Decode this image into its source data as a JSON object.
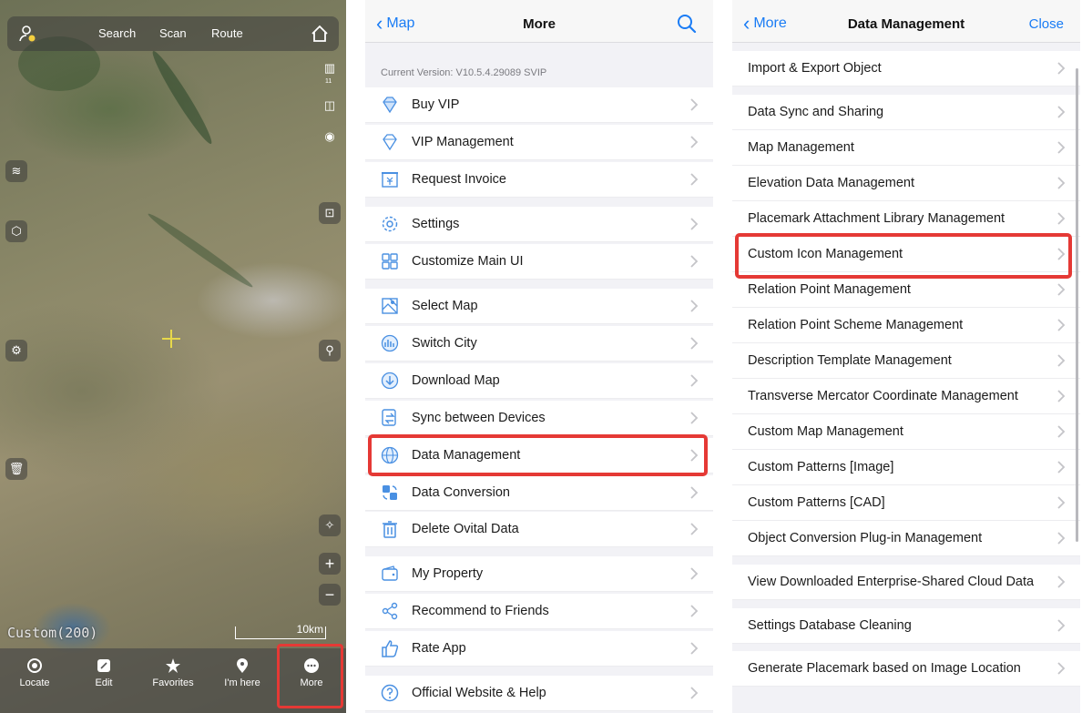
{
  "map_screen": {
    "top_bar": {
      "search": "Search",
      "scan": "Scan",
      "route": "Route"
    },
    "map_source_label": "Custom(200)",
    "scale_label": "10km",
    "bottom_tabs": [
      {
        "label": "Locate",
        "icon": "locate-icon"
      },
      {
        "label": "Edit",
        "icon": "edit-icon"
      },
      {
        "label": "Favorites",
        "icon": "star-icon"
      },
      {
        "label": "I'm here",
        "icon": "pin-icon"
      },
      {
        "label": "More",
        "icon": "more-icon"
      }
    ],
    "side_small_label": "11"
  },
  "more_screen": {
    "back_label": "Map",
    "title": "More",
    "version": "Current Version: V10.5.4.29089 SVIP",
    "items": [
      {
        "label": "Buy VIP",
        "icon": "diamond-icon"
      },
      {
        "label": "VIP Management",
        "icon": "diamond-outline-icon"
      },
      {
        "label": "Request Invoice",
        "icon": "invoice-icon"
      },
      {
        "label": "Settings",
        "icon": "gear-icon"
      },
      {
        "label": "Customize Main UI",
        "icon": "grid-icon"
      },
      {
        "label": "Select Map",
        "icon": "map-icon"
      },
      {
        "label": "Switch City",
        "icon": "city-icon"
      },
      {
        "label": "Download Map",
        "icon": "download-icon"
      },
      {
        "label": "Sync between Devices",
        "icon": "sync-icon"
      },
      {
        "label": "Data Management",
        "icon": "globe-icon"
      },
      {
        "label": "Data Conversion",
        "icon": "convert-icon"
      },
      {
        "label": "Delete Ovital Data",
        "icon": "trash-icon"
      },
      {
        "label": "My Property",
        "icon": "wallet-icon"
      },
      {
        "label": "Recommend to Friends",
        "icon": "share-icon"
      },
      {
        "label": "Rate App",
        "icon": "thumbs-up-icon"
      },
      {
        "label": "Official Website & Help",
        "icon": "help-icon"
      }
    ]
  },
  "data_screen": {
    "back_label": "More",
    "title": "Data Management",
    "close_label": "Close",
    "items": [
      "Import & Export Object",
      "Data Sync and Sharing",
      "Map Management",
      "Elevation Data Management",
      "Placemark Attachment Library Management",
      "Custom Icon Management",
      "Relation Point Management",
      "Relation Point Scheme Management",
      "Description Template Management",
      "Transverse Mercator Coordinate Management",
      "Custom Map Management",
      "Custom Patterns [Image]",
      "Custom Patterns [CAD]",
      "Object Conversion Plug-in Management",
      "View Downloaded Enterprise-Shared Cloud Data",
      "Settings Database Cleaning",
      "Generate Placemark based on Image Location"
    ]
  },
  "colors": {
    "accent": "#1a7cf5",
    "highlight": "#e53935"
  }
}
